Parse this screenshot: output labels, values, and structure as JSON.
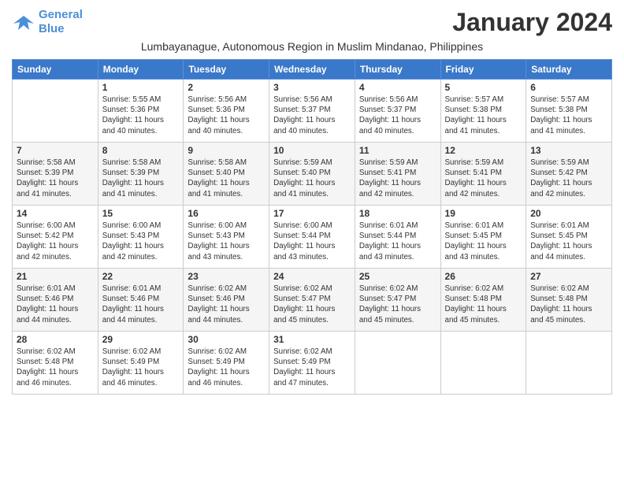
{
  "header": {
    "logo_line1": "General",
    "logo_line2": "Blue",
    "month_title": "January 2024",
    "subtitle": "Lumbayanague, Autonomous Region in Muslim Mindanao, Philippines"
  },
  "days_of_week": [
    "Sunday",
    "Monday",
    "Tuesday",
    "Wednesday",
    "Thursday",
    "Friday",
    "Saturday"
  ],
  "weeks": [
    [
      {
        "day": "",
        "info": ""
      },
      {
        "day": "1",
        "info": "Sunrise: 5:55 AM\nSunset: 5:36 PM\nDaylight: 11 hours\nand 40 minutes."
      },
      {
        "day": "2",
        "info": "Sunrise: 5:56 AM\nSunset: 5:36 PM\nDaylight: 11 hours\nand 40 minutes."
      },
      {
        "day": "3",
        "info": "Sunrise: 5:56 AM\nSunset: 5:37 PM\nDaylight: 11 hours\nand 40 minutes."
      },
      {
        "day": "4",
        "info": "Sunrise: 5:56 AM\nSunset: 5:37 PM\nDaylight: 11 hours\nand 40 minutes."
      },
      {
        "day": "5",
        "info": "Sunrise: 5:57 AM\nSunset: 5:38 PM\nDaylight: 11 hours\nand 41 minutes."
      },
      {
        "day": "6",
        "info": "Sunrise: 5:57 AM\nSunset: 5:38 PM\nDaylight: 11 hours\nand 41 minutes."
      }
    ],
    [
      {
        "day": "7",
        "info": "Sunrise: 5:58 AM\nSunset: 5:39 PM\nDaylight: 11 hours\nand 41 minutes."
      },
      {
        "day": "8",
        "info": "Sunrise: 5:58 AM\nSunset: 5:39 PM\nDaylight: 11 hours\nand 41 minutes."
      },
      {
        "day": "9",
        "info": "Sunrise: 5:58 AM\nSunset: 5:40 PM\nDaylight: 11 hours\nand 41 minutes."
      },
      {
        "day": "10",
        "info": "Sunrise: 5:59 AM\nSunset: 5:40 PM\nDaylight: 11 hours\nand 41 minutes."
      },
      {
        "day": "11",
        "info": "Sunrise: 5:59 AM\nSunset: 5:41 PM\nDaylight: 11 hours\nand 42 minutes."
      },
      {
        "day": "12",
        "info": "Sunrise: 5:59 AM\nSunset: 5:41 PM\nDaylight: 11 hours\nand 42 minutes."
      },
      {
        "day": "13",
        "info": "Sunrise: 5:59 AM\nSunset: 5:42 PM\nDaylight: 11 hours\nand 42 minutes."
      }
    ],
    [
      {
        "day": "14",
        "info": "Sunrise: 6:00 AM\nSunset: 5:42 PM\nDaylight: 11 hours\nand 42 minutes."
      },
      {
        "day": "15",
        "info": "Sunrise: 6:00 AM\nSunset: 5:43 PM\nDaylight: 11 hours\nand 42 minutes."
      },
      {
        "day": "16",
        "info": "Sunrise: 6:00 AM\nSunset: 5:43 PM\nDaylight: 11 hours\nand 43 minutes."
      },
      {
        "day": "17",
        "info": "Sunrise: 6:00 AM\nSunset: 5:44 PM\nDaylight: 11 hours\nand 43 minutes."
      },
      {
        "day": "18",
        "info": "Sunrise: 6:01 AM\nSunset: 5:44 PM\nDaylight: 11 hours\nand 43 minutes."
      },
      {
        "day": "19",
        "info": "Sunrise: 6:01 AM\nSunset: 5:45 PM\nDaylight: 11 hours\nand 43 minutes."
      },
      {
        "day": "20",
        "info": "Sunrise: 6:01 AM\nSunset: 5:45 PM\nDaylight: 11 hours\nand 44 minutes."
      }
    ],
    [
      {
        "day": "21",
        "info": "Sunrise: 6:01 AM\nSunset: 5:46 PM\nDaylight: 11 hours\nand 44 minutes."
      },
      {
        "day": "22",
        "info": "Sunrise: 6:01 AM\nSunset: 5:46 PM\nDaylight: 11 hours\nand 44 minutes."
      },
      {
        "day": "23",
        "info": "Sunrise: 6:02 AM\nSunset: 5:46 PM\nDaylight: 11 hours\nand 44 minutes."
      },
      {
        "day": "24",
        "info": "Sunrise: 6:02 AM\nSunset: 5:47 PM\nDaylight: 11 hours\nand 45 minutes."
      },
      {
        "day": "25",
        "info": "Sunrise: 6:02 AM\nSunset: 5:47 PM\nDaylight: 11 hours\nand 45 minutes."
      },
      {
        "day": "26",
        "info": "Sunrise: 6:02 AM\nSunset: 5:48 PM\nDaylight: 11 hours\nand 45 minutes."
      },
      {
        "day": "27",
        "info": "Sunrise: 6:02 AM\nSunset: 5:48 PM\nDaylight: 11 hours\nand 45 minutes."
      }
    ],
    [
      {
        "day": "28",
        "info": "Sunrise: 6:02 AM\nSunset: 5:48 PM\nDaylight: 11 hours\nand 46 minutes."
      },
      {
        "day": "29",
        "info": "Sunrise: 6:02 AM\nSunset: 5:49 PM\nDaylight: 11 hours\nand 46 minutes."
      },
      {
        "day": "30",
        "info": "Sunrise: 6:02 AM\nSunset: 5:49 PM\nDaylight: 11 hours\nand 46 minutes."
      },
      {
        "day": "31",
        "info": "Sunrise: 6:02 AM\nSunset: 5:49 PM\nDaylight: 11 hours\nand 47 minutes."
      },
      {
        "day": "",
        "info": ""
      },
      {
        "day": "",
        "info": ""
      },
      {
        "day": "",
        "info": ""
      }
    ]
  ]
}
